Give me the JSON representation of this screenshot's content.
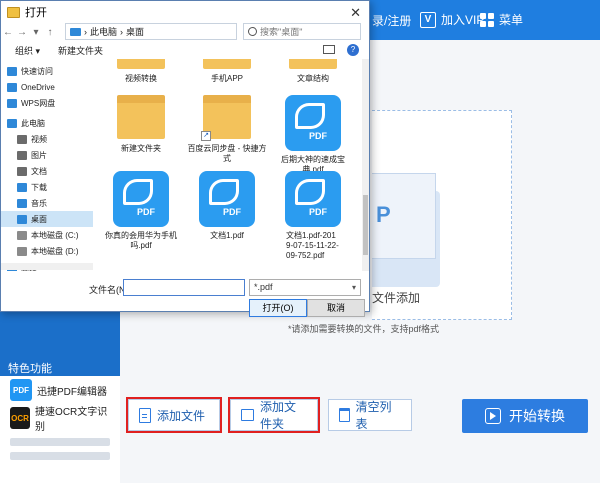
{
  "app": {
    "header": {
      "login_register": "录/注册",
      "vip_label": "加入VIP",
      "vip_badge": "V",
      "menu_label": "菜单"
    },
    "sidebar": {
      "section_title": "特色功能",
      "tools": [
        {
          "icon": "pdf-editor-icon",
          "label": "迅捷PDF编辑器",
          "icon_text": "PDF"
        },
        {
          "icon": "ocr-icon",
          "label": "捷速OCR文字识别",
          "icon_text": "OCR"
        }
      ]
    },
    "dropzone": {
      "add_file_text": "文件添加",
      "hint": "*请添加需要转换的文件，支持pdf格式"
    },
    "actions": {
      "add_file": "添加文件",
      "add_folder": "添加文件夹",
      "clear_list": "清空列表",
      "start_convert": "开始转换"
    },
    "colors": {
      "header_blue": "#1f7ee0",
      "sidebar_blue": "#1b6fc9",
      "highlight_red": "#e02020",
      "start_button": "#2d7de0"
    }
  },
  "dialog": {
    "title": "打开",
    "breadcrumb": [
      "此电脑",
      "桌面"
    ],
    "search_placeholder": "搜索\"桌面\"",
    "toolbar": {
      "organize": "组织 ▾",
      "new_folder": "新建文件夹"
    },
    "nav_items": [
      {
        "label": "快速访问",
        "icon": "star-icon",
        "color": "#2e88d8"
      },
      {
        "label": "OneDrive",
        "icon": "cloud-icon",
        "color": "#2e88d8"
      },
      {
        "label": "WPS网盘",
        "icon": "cloud-icon",
        "color": "#2e88d8"
      },
      {
        "label": "此电脑",
        "icon": "pc-icon",
        "color": "#2e88d8"
      },
      {
        "label": "视频",
        "icon": "video-icon",
        "color": "#6b6b6b"
      },
      {
        "label": "图片",
        "icon": "picture-icon",
        "color": "#6b6b6b"
      },
      {
        "label": "文档",
        "icon": "document-icon",
        "color": "#6b6b6b"
      },
      {
        "label": "下载",
        "icon": "download-icon",
        "color": "#2e88d8"
      },
      {
        "label": "音乐",
        "icon": "music-icon",
        "color": "#2e88d8"
      },
      {
        "label": "桌面",
        "icon": "desktop-icon",
        "color": "#2e88d8",
        "selected": true
      },
      {
        "label": "本地磁盘 (C:)",
        "icon": "drive-icon",
        "color": "#8a8a8a"
      },
      {
        "label": "本地磁盘 (D:)",
        "icon": "drive-icon",
        "color": "#8a8a8a"
      },
      {
        "label": "网络",
        "icon": "network-icon",
        "color": "#2e88d8"
      }
    ],
    "files": [
      {
        "name": "视频转换",
        "type": "folder"
      },
      {
        "name": "手机APP",
        "type": "folder"
      },
      {
        "name": "文章结构",
        "type": "folder"
      },
      {
        "name": "新建文件夹",
        "type": "folder"
      },
      {
        "name": "百度云同步盘 - 快捷方式",
        "type": "shortcut"
      },
      {
        "name": "后期大神的速成宝典.pdf",
        "type": "pdf"
      },
      {
        "name": "你真的会用华为手机吗.pdf",
        "type": "pdf"
      },
      {
        "name": "文档1.pdf",
        "type": "pdf"
      },
      {
        "name": "文档1.pdf-2019-07-15-11-22-09-752.pdf",
        "type": "pdf"
      }
    ],
    "filename_label": "文件名(N):",
    "filename_value": "",
    "filetype_value": "*.pdf",
    "open_button": "打开(O)",
    "cancel_button": "取消"
  }
}
